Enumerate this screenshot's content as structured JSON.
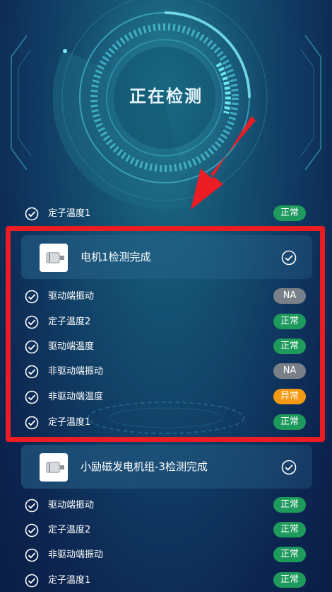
{
  "status_text": "正在检测",
  "badge_colors": {
    "ok": "#1e9a5c",
    "na": "#7a8088",
    "warn": "#f39a12"
  },
  "top_row": {
    "label": "定子温度1",
    "badge": "正常",
    "state": "ok"
  },
  "motors": [
    {
      "title": "电机1检测完成",
      "items": [
        {
          "label": "驱动端振动",
          "badge": "NA",
          "state": "na"
        },
        {
          "label": "定子温度2",
          "badge": "正常",
          "state": "ok"
        },
        {
          "label": "驱动端温度",
          "badge": "正常",
          "state": "ok"
        },
        {
          "label": "非驱动端振动",
          "badge": "NA",
          "state": "na"
        },
        {
          "label": "非驱动端温度",
          "badge": "异常",
          "state": "warn"
        },
        {
          "label": "定子温度1",
          "badge": "正常",
          "state": "ok"
        }
      ]
    },
    {
      "title": "小励磁发电机组-3检测完成",
      "items": [
        {
          "label": "驱动端振动",
          "badge": "正常",
          "state": "ok"
        },
        {
          "label": "定子温度2",
          "badge": "正常",
          "state": "ok"
        },
        {
          "label": "非驱动端振动",
          "badge": "正常",
          "state": "ok"
        },
        {
          "label": "定子温度1",
          "badge": "正常",
          "state": "ok"
        }
      ]
    }
  ]
}
